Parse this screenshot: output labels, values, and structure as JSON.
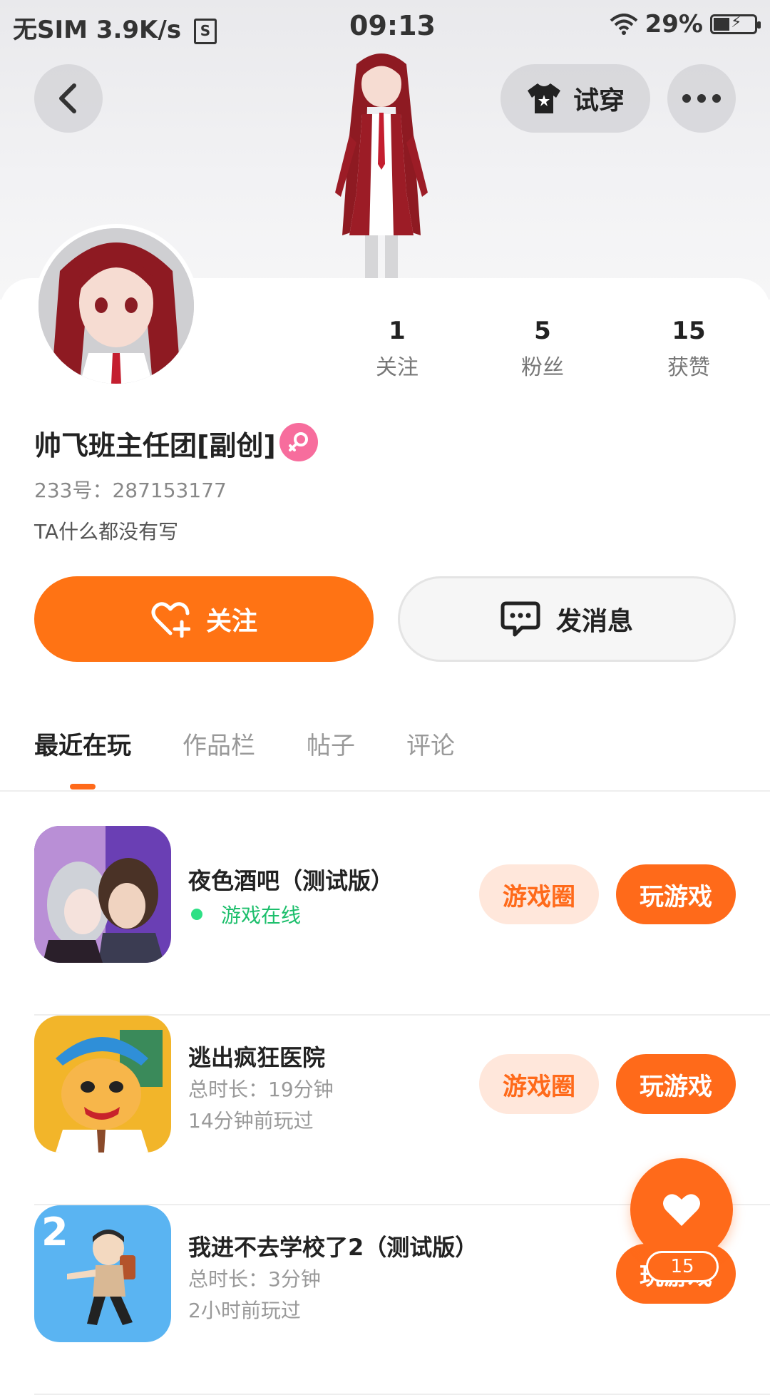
{
  "status_bar": {
    "carrier": "无SIM",
    "speed": "3.9K/s",
    "sim_icon": "S",
    "time": "09:13",
    "battery": "29%"
  },
  "header": {
    "back_icon": "chevron-left",
    "tryon_label": "试穿",
    "more_icon": "ellipsis"
  },
  "profile": {
    "username": "帅飞班主任团[副创]",
    "gender_icon": "female",
    "uid": "233号：287153177",
    "bio": "TA什么都没有写",
    "stats": [
      {
        "value": "1",
        "label": "关注"
      },
      {
        "value": "5",
        "label": "粉丝"
      },
      {
        "value": "15",
        "label": "获赞"
      }
    ]
  },
  "actions": {
    "follow_label": "关注",
    "message_label": "发消息"
  },
  "tabs": [
    "最近在玩",
    "作品栏",
    "帖子",
    "评论"
  ],
  "games": [
    {
      "title": "夜色酒吧（测试版）",
      "status": "游戏在线",
      "circle_label": "游戏圈",
      "play_label": "玩游戏"
    },
    {
      "title": "逃出疯狂医院",
      "duration": "总时长：19分钟",
      "last_played": "14分钟前玩过",
      "circle_label": "游戏圈",
      "play_label": "玩游戏"
    },
    {
      "title": "我进不去学校了2（测试版）",
      "duration": "总时长：3分钟",
      "last_played": "2小时前玩过",
      "play_label": "玩游戏"
    }
  ],
  "like_fab": {
    "count": "15"
  },
  "colors": {
    "accent": "#ff6a1a",
    "online": "#1dbf6c",
    "gender": "#f76d9d"
  }
}
